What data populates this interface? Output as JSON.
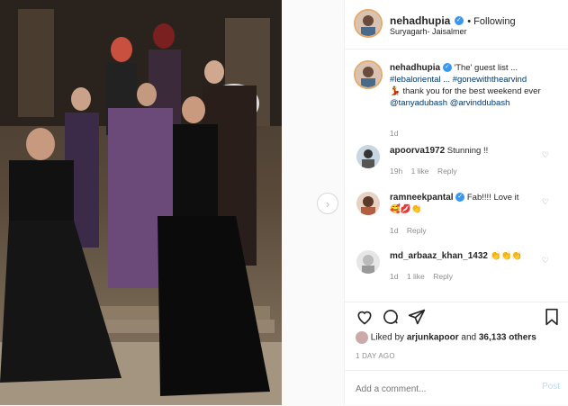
{
  "post": {
    "username": "nehadhupia",
    "following": "• Following",
    "location": "Suryagarh- Jaisalmer"
  },
  "caption": {
    "username": "nehadhupia",
    "text_1": "'The' guest list ...",
    "tags_1": "#lebaloriental ... #gonewiththearvind",
    "text_2": "💃 thank you for the best weekend ever",
    "mentions": "@tanyadubash @arvinddubash",
    "age": "1d"
  },
  "comments": [
    {
      "user": "apoorva1972",
      "text": "Stunning !!",
      "age": "19h",
      "likes": "1 like",
      "reply": "Reply"
    },
    {
      "user": "ramneekpantal",
      "text": "Fab!!!! Love it",
      "emoji": "🥰💋👏",
      "age": "1d",
      "likes": "",
      "reply": "Reply"
    },
    {
      "user": "md_arbaaz_khan_1432",
      "text": "👏👏👏",
      "age": "1d",
      "likes": "1 like",
      "reply": "Reply"
    }
  ],
  "likes": {
    "prefix": "Liked by",
    "user": "arjunkapoor",
    "and": "and",
    "count": "36,133 others"
  },
  "timestamp": "1 DAY AGO",
  "add_comment": {
    "placeholder": "Add a comment...",
    "post_label": "Post"
  },
  "icons": {
    "next": "chevron-right-icon",
    "like": "heart-icon",
    "comment": "comment-icon",
    "share": "share-icon",
    "save": "bookmark-icon"
  }
}
